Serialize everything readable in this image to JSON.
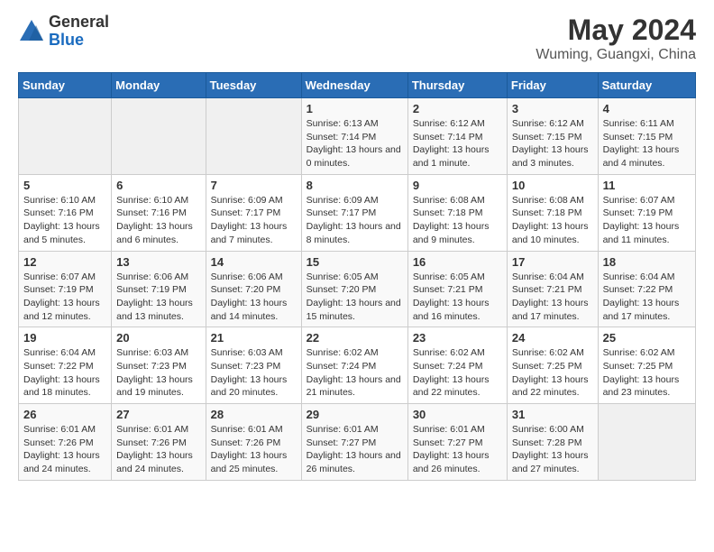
{
  "header": {
    "logo_line1": "General",
    "logo_line2": "Blue",
    "main_title": "May 2024",
    "subtitle": "Wuming, Guangxi, China"
  },
  "weekdays": [
    "Sunday",
    "Monday",
    "Tuesday",
    "Wednesday",
    "Thursday",
    "Friday",
    "Saturday"
  ],
  "weeks": [
    [
      {
        "day": "",
        "sunrise": "",
        "sunset": "",
        "daylight": ""
      },
      {
        "day": "",
        "sunrise": "",
        "sunset": "",
        "daylight": ""
      },
      {
        "day": "",
        "sunrise": "",
        "sunset": "",
        "daylight": ""
      },
      {
        "day": "1",
        "sunrise": "Sunrise: 6:13 AM",
        "sunset": "Sunset: 7:14 PM",
        "daylight": "Daylight: 13 hours and 0 minutes."
      },
      {
        "day": "2",
        "sunrise": "Sunrise: 6:12 AM",
        "sunset": "Sunset: 7:14 PM",
        "daylight": "Daylight: 13 hours and 1 minute."
      },
      {
        "day": "3",
        "sunrise": "Sunrise: 6:12 AM",
        "sunset": "Sunset: 7:15 PM",
        "daylight": "Daylight: 13 hours and 3 minutes."
      },
      {
        "day": "4",
        "sunrise": "Sunrise: 6:11 AM",
        "sunset": "Sunset: 7:15 PM",
        "daylight": "Daylight: 13 hours and 4 minutes."
      }
    ],
    [
      {
        "day": "5",
        "sunrise": "Sunrise: 6:10 AM",
        "sunset": "Sunset: 7:16 PM",
        "daylight": "Daylight: 13 hours and 5 minutes."
      },
      {
        "day": "6",
        "sunrise": "Sunrise: 6:10 AM",
        "sunset": "Sunset: 7:16 PM",
        "daylight": "Daylight: 13 hours and 6 minutes."
      },
      {
        "day": "7",
        "sunrise": "Sunrise: 6:09 AM",
        "sunset": "Sunset: 7:17 PM",
        "daylight": "Daylight: 13 hours and 7 minutes."
      },
      {
        "day": "8",
        "sunrise": "Sunrise: 6:09 AM",
        "sunset": "Sunset: 7:17 PM",
        "daylight": "Daylight: 13 hours and 8 minutes."
      },
      {
        "day": "9",
        "sunrise": "Sunrise: 6:08 AM",
        "sunset": "Sunset: 7:18 PM",
        "daylight": "Daylight: 13 hours and 9 minutes."
      },
      {
        "day": "10",
        "sunrise": "Sunrise: 6:08 AM",
        "sunset": "Sunset: 7:18 PM",
        "daylight": "Daylight: 13 hours and 10 minutes."
      },
      {
        "day": "11",
        "sunrise": "Sunrise: 6:07 AM",
        "sunset": "Sunset: 7:19 PM",
        "daylight": "Daylight: 13 hours and 11 minutes."
      }
    ],
    [
      {
        "day": "12",
        "sunrise": "Sunrise: 6:07 AM",
        "sunset": "Sunset: 7:19 PM",
        "daylight": "Daylight: 13 hours and 12 minutes."
      },
      {
        "day": "13",
        "sunrise": "Sunrise: 6:06 AM",
        "sunset": "Sunset: 7:19 PM",
        "daylight": "Daylight: 13 hours and 13 minutes."
      },
      {
        "day": "14",
        "sunrise": "Sunrise: 6:06 AM",
        "sunset": "Sunset: 7:20 PM",
        "daylight": "Daylight: 13 hours and 14 minutes."
      },
      {
        "day": "15",
        "sunrise": "Sunrise: 6:05 AM",
        "sunset": "Sunset: 7:20 PM",
        "daylight": "Daylight: 13 hours and 15 minutes."
      },
      {
        "day": "16",
        "sunrise": "Sunrise: 6:05 AM",
        "sunset": "Sunset: 7:21 PM",
        "daylight": "Daylight: 13 hours and 16 minutes."
      },
      {
        "day": "17",
        "sunrise": "Sunrise: 6:04 AM",
        "sunset": "Sunset: 7:21 PM",
        "daylight": "Daylight: 13 hours and 17 minutes."
      },
      {
        "day": "18",
        "sunrise": "Sunrise: 6:04 AM",
        "sunset": "Sunset: 7:22 PM",
        "daylight": "Daylight: 13 hours and 17 minutes."
      }
    ],
    [
      {
        "day": "19",
        "sunrise": "Sunrise: 6:04 AM",
        "sunset": "Sunset: 7:22 PM",
        "daylight": "Daylight: 13 hours and 18 minutes."
      },
      {
        "day": "20",
        "sunrise": "Sunrise: 6:03 AM",
        "sunset": "Sunset: 7:23 PM",
        "daylight": "Daylight: 13 hours and 19 minutes."
      },
      {
        "day": "21",
        "sunrise": "Sunrise: 6:03 AM",
        "sunset": "Sunset: 7:23 PM",
        "daylight": "Daylight: 13 hours and 20 minutes."
      },
      {
        "day": "22",
        "sunrise": "Sunrise: 6:02 AM",
        "sunset": "Sunset: 7:24 PM",
        "daylight": "Daylight: 13 hours and 21 minutes."
      },
      {
        "day": "23",
        "sunrise": "Sunrise: 6:02 AM",
        "sunset": "Sunset: 7:24 PM",
        "daylight": "Daylight: 13 hours and 22 minutes."
      },
      {
        "day": "24",
        "sunrise": "Sunrise: 6:02 AM",
        "sunset": "Sunset: 7:25 PM",
        "daylight": "Daylight: 13 hours and 22 minutes."
      },
      {
        "day": "25",
        "sunrise": "Sunrise: 6:02 AM",
        "sunset": "Sunset: 7:25 PM",
        "daylight": "Daylight: 13 hours and 23 minutes."
      }
    ],
    [
      {
        "day": "26",
        "sunrise": "Sunrise: 6:01 AM",
        "sunset": "Sunset: 7:26 PM",
        "daylight": "Daylight: 13 hours and 24 minutes."
      },
      {
        "day": "27",
        "sunrise": "Sunrise: 6:01 AM",
        "sunset": "Sunset: 7:26 PM",
        "daylight": "Daylight: 13 hours and 24 minutes."
      },
      {
        "day": "28",
        "sunrise": "Sunrise: 6:01 AM",
        "sunset": "Sunset: 7:26 PM",
        "daylight": "Daylight: 13 hours and 25 minutes."
      },
      {
        "day": "29",
        "sunrise": "Sunrise: 6:01 AM",
        "sunset": "Sunset: 7:27 PM",
        "daylight": "Daylight: 13 hours and 26 minutes."
      },
      {
        "day": "30",
        "sunrise": "Sunrise: 6:01 AM",
        "sunset": "Sunset: 7:27 PM",
        "daylight": "Daylight: 13 hours and 26 minutes."
      },
      {
        "day": "31",
        "sunrise": "Sunrise: 6:00 AM",
        "sunset": "Sunset: 7:28 PM",
        "daylight": "Daylight: 13 hours and 27 minutes."
      },
      {
        "day": "",
        "sunrise": "",
        "sunset": "",
        "daylight": ""
      }
    ]
  ]
}
